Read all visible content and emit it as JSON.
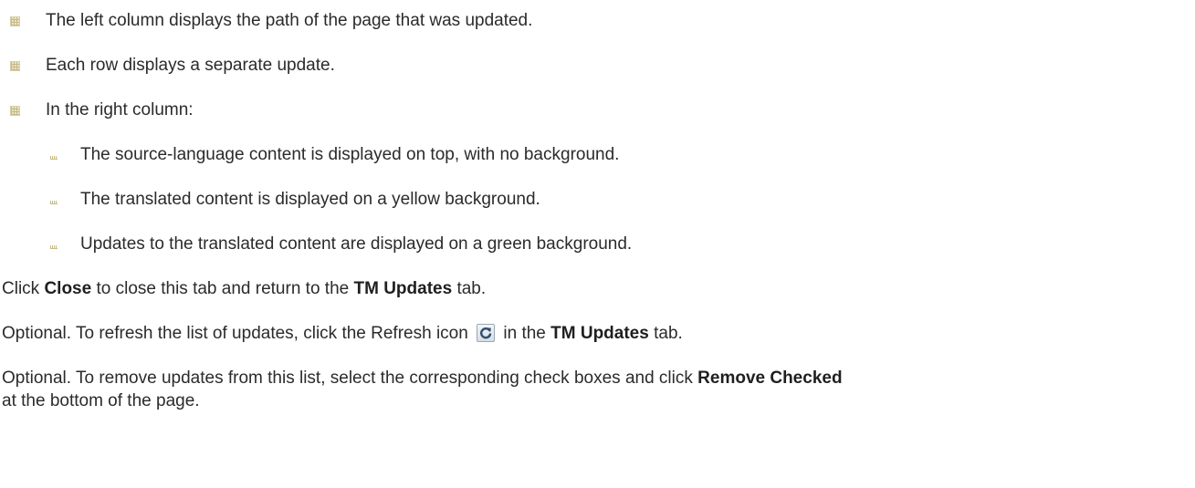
{
  "bullets_level1": [
    "The left column displays the path of the page that was updated.",
    "Each row displays a separate update.",
    "In the right column:"
  ],
  "bullets_level2": [
    "The source-language content is displayed on top, with no background.",
    "The translated content is displayed on a yellow background.",
    "Updates to the translated content are displayed on a green background."
  ],
  "para_close": {
    "t1": "Click ",
    "b1": "Close",
    "t2": " to close this tab and return to the ",
    "b2": "TM Updates",
    "t3": " tab."
  },
  "para_refresh": {
    "t1": "Optional. To refresh the list of updates, click the Refresh icon",
    "icon": "refresh-icon",
    "t2": " in the ",
    "b1": "TM Updates",
    "t3": " tab."
  },
  "para_remove": {
    "t1": "Optional. To remove updates from this list, select the corresponding check boxes and click ",
    "b1": "Remove Checked",
    "t2": " at the bottom of the page."
  }
}
